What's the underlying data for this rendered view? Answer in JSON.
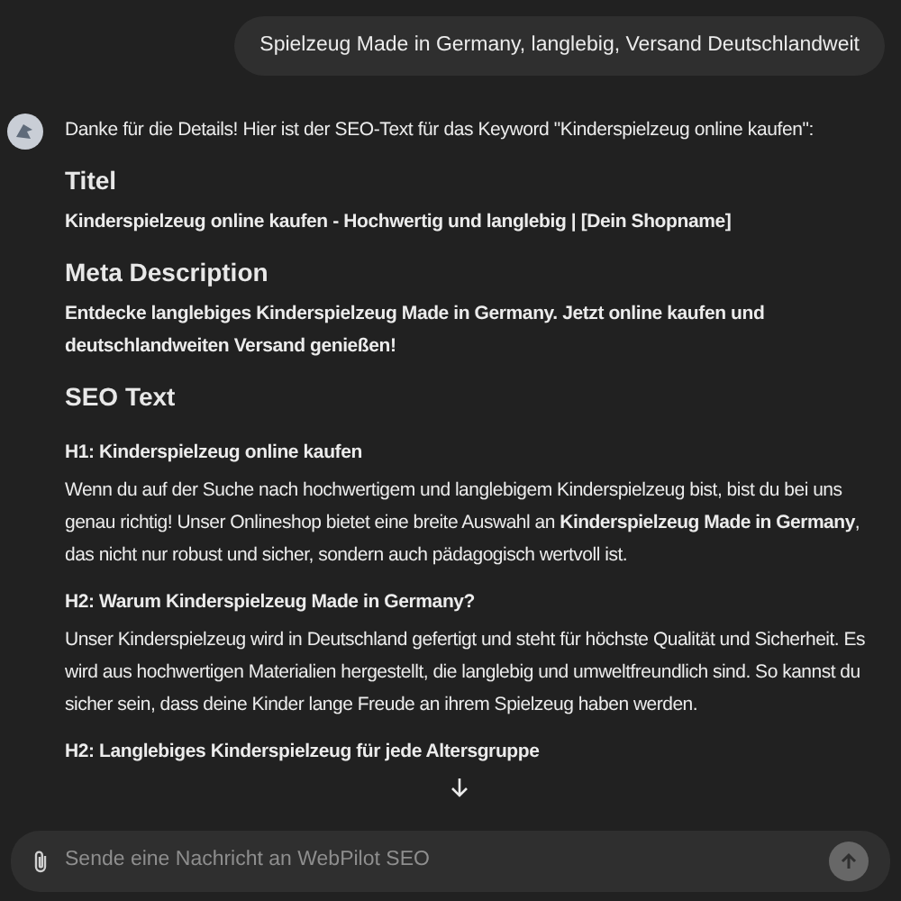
{
  "user_message": "Spielzeug Made in Germany, langlebig, Versand Deutschlandweit",
  "assistant": {
    "intro": "Danke für die Details! Hier ist der SEO-Text für das Keyword \"Kinderspielzeug online kaufen\":",
    "blocks": [
      {
        "kind": "heading",
        "text": "Titel"
      },
      {
        "kind": "bold",
        "text": "Kinderspielzeug online kaufen - Hochwertig und langlebig | [Dein Shopname]"
      },
      {
        "kind": "heading",
        "text": "Meta Description"
      },
      {
        "kind": "bold",
        "text": "Entdecke langlebiges Kinderspielzeug Made in Germany. Jetzt online kaufen und deutschlandweiten Versand genießen!"
      },
      {
        "kind": "heading",
        "text": "SEO Text"
      },
      {
        "kind": "subheading",
        "text": "H1: Kinderspielzeug online kaufen"
      },
      {
        "kind": "paragraph",
        "text": "Wenn du auf der Suche nach hochwertigem und langlebigem Kinderspielzeug bist, bist du bei uns genau richtig! Unser Onlineshop bietet eine breite Auswahl an **Kinderspielzeug Made in Germany**, das nicht nur robust und sicher, sondern auch pädagogisch wertvoll ist."
      },
      {
        "kind": "subheading",
        "text": "H2: Warum Kinderspielzeug Made in Germany?"
      },
      {
        "kind": "paragraph",
        "text": "Unser Kinderspielzeug wird in Deutschland gefertigt und steht für höchste Qualität und Sicherheit. Es wird aus hochwertigen Materialien hergestellt, die langlebig und umweltfreundlich sind. So kannst du sicher sein, dass deine Kinder lange Freude an ihrem Spielzeug haben werden."
      },
      {
        "kind": "subheading",
        "text": "H2: Langlebiges Kinderspielzeug für jede Altersgruppe"
      }
    ]
  },
  "composer": {
    "placeholder": "Sende eine Nachricht an WebPilot SEO"
  }
}
